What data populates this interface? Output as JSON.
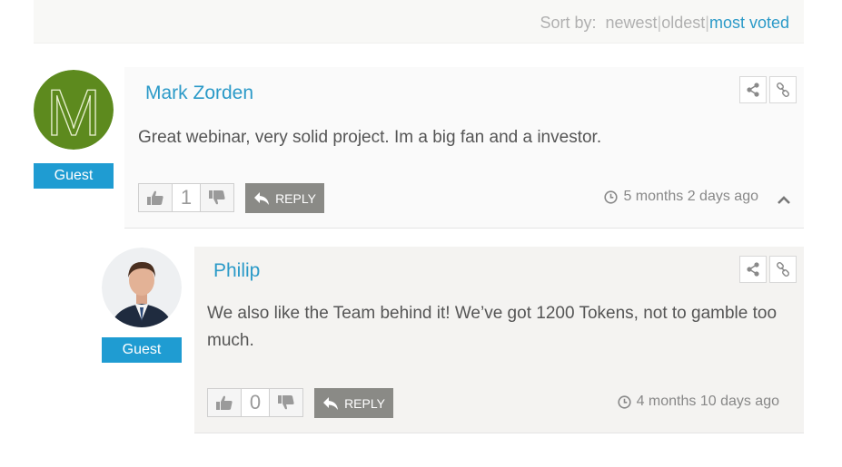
{
  "sort": {
    "label": "Sort by:",
    "options": [
      "newest",
      "oldest",
      "most voted"
    ],
    "separator": "|",
    "active": "most voted"
  },
  "colors": {
    "accent": "#2b9ac8",
    "badge": "#1f9cd2",
    "reply_button": "#8a8a86",
    "avatar_green": "#5d8a1e"
  },
  "comments": [
    {
      "author": "Mark Zorden",
      "avatar_letter": "M",
      "role_badge": "Guest",
      "text": "Great webinar, very solid project. Im a big fan and a investor.",
      "votes": "1",
      "reply_label": "REPLY",
      "time": "5 months 2 days ago",
      "icons": [
        "share-icon",
        "link-icon",
        "thumbs-up-icon",
        "thumbs-down-icon",
        "reply-arrow-icon",
        "clock-icon",
        "chevron-up-icon"
      ]
    },
    {
      "author": "Philip",
      "role_badge": "Guest",
      "text": "We also like the Team behind it! We’ve got 1200 Tokens, not to gamble too much.",
      "votes": "0",
      "reply_label": "REPLY",
      "time": "4 months 10 days ago",
      "icons": [
        "share-icon",
        "link-icon",
        "thumbs-up-icon",
        "thumbs-down-icon",
        "reply-arrow-icon",
        "clock-icon"
      ]
    }
  ]
}
